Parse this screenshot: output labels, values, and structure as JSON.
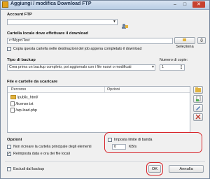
{
  "window": {
    "title": "Aggiungi / modifica Download FTP",
    "min": "–",
    "max": "□",
    "close": "✕"
  },
  "account": {
    "label": "Account FTP",
    "value": "",
    "edit_icon": "user-gear-icon"
  },
  "folder": {
    "label": "Cartella locale dove effettuare il download",
    "value": "c:\\Mypc\\Test",
    "browse_label": "Seleziona",
    "braces_label": "{}",
    "copy_label": "Copia questa cartella nelle destinazioni del job appena completato il download",
    "copy_checked": false
  },
  "backup": {
    "type_label": "Tipo di backup",
    "type_value": "Crea prima un backup completo, poi aggiornalo con i file nuovi o modificati",
    "copies_label": "Numero di copie:",
    "copies_value": "1"
  },
  "files": {
    "label": "File e cartelle da scaricare",
    "columns": [
      "Percorso",
      "Opzioni"
    ],
    "rows": [
      {
        "name": "/public_html/",
        "icon": "folder-icon"
      },
      {
        "name": "/license.txt",
        "icon": "file-icon"
      },
      {
        "name": "/wp-load.php",
        "icon": "file-icon"
      }
    ]
  },
  "options": {
    "label": "Opzioni",
    "no_recreate": {
      "label": "Non ricreare la cartella principale degli elementi",
      "checked": false
    },
    "reset_date": {
      "label": "Reimposta data e ora dei file locali",
      "checked": true
    },
    "bandwidth": {
      "label": "Imposta limite di banda",
      "checked": false,
      "value": "0",
      "unit": "KB/s"
    }
  },
  "footer": {
    "exclude": {
      "label": "Escludi dal backup",
      "checked": false
    },
    "ok_label": "OK",
    "cancel_label": "Annulla"
  },
  "colors": {
    "highlight": "#d8262c",
    "title_bg": "#c9d9ee"
  }
}
